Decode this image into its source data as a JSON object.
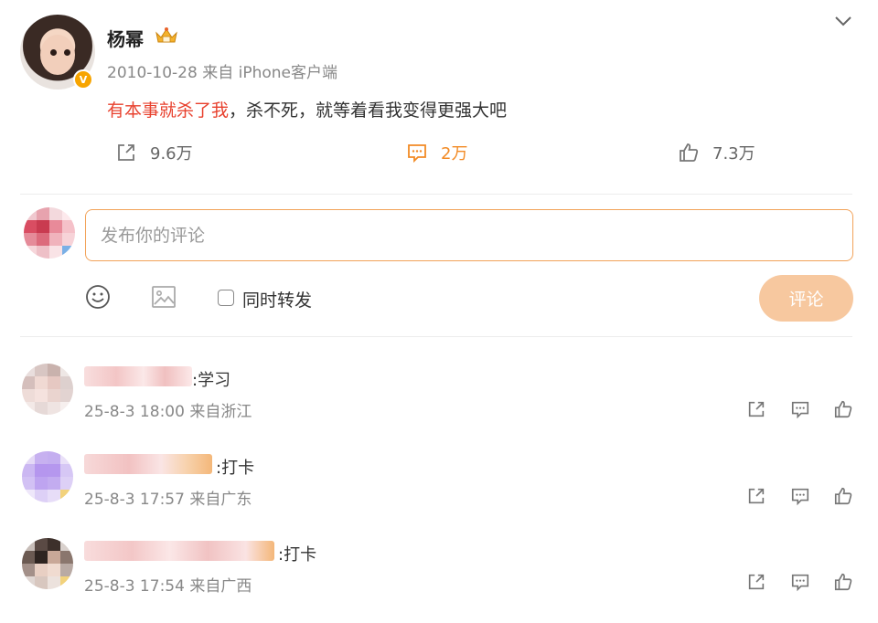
{
  "post": {
    "author": "杨幂",
    "meta": "2010-10-28 来自 iPhone客户端",
    "text_highlight": "有本事就杀了我",
    "text_rest": "，杀不死，就等着看我变得更强大吧",
    "badge": "V",
    "actions": {
      "repost": "9.6万",
      "comment": "2万",
      "like": "7.3万"
    }
  },
  "composer": {
    "placeholder": "发布你的评论",
    "sync_repost_label": "同时转发",
    "submit_label": "评论"
  },
  "comments": [
    {
      "text": ":学习",
      "meta": "25-8-3 18:00 来自浙江"
    },
    {
      "text": ":打卡",
      "meta": "25-8-3 17:57 来自广东"
    },
    {
      "text": ":打卡",
      "meta": "25-8-3 17:54 来自广西"
    }
  ],
  "colors": {
    "accent_orange": "#f28a24",
    "highlight_red": "#e8412e",
    "submit_disabled": "#f7c89f",
    "input_border": "#f2a35a"
  },
  "icons": [
    "crown-icon",
    "chevron-down-icon",
    "repost-icon",
    "comment-icon",
    "like-icon",
    "emoji-icon",
    "image-icon",
    "verified-icon"
  ]
}
